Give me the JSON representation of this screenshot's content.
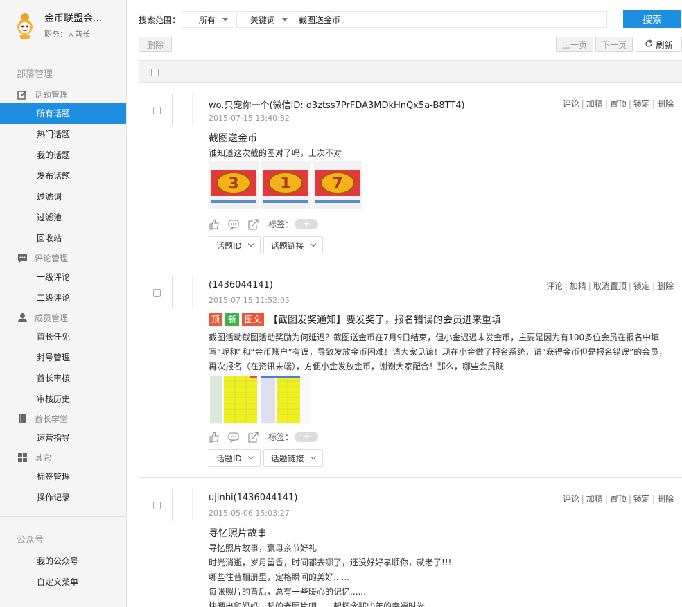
{
  "sidebar": {
    "org_name": "金币联盟会...",
    "role": "职务：大酋长",
    "section_tribe": "部落管理",
    "groups": {
      "topics": "话题管理",
      "comments": "评论管理",
      "members": "成员管理",
      "school": "酋长学堂",
      "other": "其它"
    },
    "items": {
      "all_topics": "所有话题",
      "hot_topics": "热门话题",
      "my_topics": "我的话题",
      "publish_topic": "发布话题",
      "filter_words": "过滤词",
      "filter_pool": "过滤池",
      "recycle": "回收站",
      "level1_comments": "一级评论",
      "level2_comments": "二级评论",
      "chief_appoint": "酋长任免",
      "ban_manage": "封号管理",
      "chief_review": "酋长审核",
      "review_history": "审核历史",
      "ops_guide": "运营指导",
      "tag_manage": "标签管理",
      "op_log": "操作记录",
      "my_official": "我的公众号",
      "custom_menu": "自定义菜单"
    },
    "section_official": "公众号"
  },
  "search": {
    "scope_label": "搜索范围：",
    "scope_value": "所有",
    "type_value": "关键词",
    "query": "截图送金币",
    "button": "搜索"
  },
  "toolbar": {
    "delete": "删除",
    "prev": "上一页",
    "next": "下一页",
    "refresh": "刷新"
  },
  "posts": [
    {
      "author": "wo.只宠你一个(微信ID: o3ztss7PrFDA3MDkHnQx5a-B8TT4)",
      "date": "2015-07-15 13:40:32",
      "actions": [
        "评论",
        "加精",
        "置顶",
        "锁定",
        "删除"
      ],
      "title": "截图送金币",
      "body": "谁知道这次截的图对了吗，上次不对",
      "thumb_numbers": [
        "3",
        "1",
        "7"
      ],
      "tag_label": "标签：",
      "dd_id": "话题ID",
      "dd_link": "话题链接"
    },
    {
      "author": "(1436044141)",
      "date": "2015-07-15 11:52:05",
      "actions": [
        "评论",
        "加精",
        "取消置顶",
        "锁定",
        "删除"
      ],
      "badges": [
        "顶",
        "新",
        "图文"
      ],
      "title": "【截图发奖通知】要发奖了，报名错误的会员进来重填",
      "body": "截图活动截图活动奖励为何延迟？截图送金币在7月9日结束，但小金迟迟未发金币，主要是因为有100多位会员在报名中填写“昵称”和“金币账户”有误，导致发放金币困难！请大家见谅！现在小金做了报名系统，请“获得金币但是报名错误”的会员，再次报名（在资讯末端），方便小金发放金币，谢谢大家配合！那么，哪些会员既",
      "tag_label": "标签：",
      "dd_id": "话题ID",
      "dd_link": "话题链接"
    },
    {
      "author": "ujinbi(1436044141)",
      "date": "2015-05-06 15:03:27",
      "actions": [
        "评论",
        "加精",
        "置顶",
        "锁定",
        "删除"
      ],
      "title": "寻忆照片故事",
      "lines": [
        "寻忆照片故事，赢母亲节好礼",
        "时光消逝，岁月留香，时间都去哪了，还没好好孝顺你，就老了!!!",
        "哪些往昔相册里，定格瞬间的美好......",
        "每张照片的背后，总有一些暖心的记忆......",
        "快晒出和妈妈一起的老照片吧，一起怀念那些年的幸福时光"
      ]
    }
  ],
  "colors": {
    "accent": "#1e8ee1",
    "badge_top": "#e8593a",
    "badge_new": "#3cb34a",
    "badge_img": "#e8593a"
  }
}
